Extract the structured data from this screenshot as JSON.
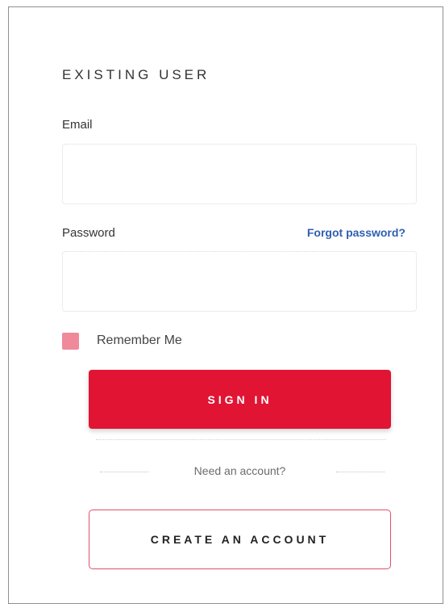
{
  "form": {
    "heading": "EXISTING USER",
    "email_label": "Email",
    "email_value": "",
    "password_label": "Password",
    "password_value": "",
    "forgot_password": "Forgot password?",
    "remember_me": "Remember Me",
    "remember_checked": true,
    "sign_in": "SIGN IN",
    "need_account": "Need an account?",
    "create_account": "CREATE AN ACCOUNT"
  },
  "colors": {
    "accent": "#e11434",
    "link": "#2f5fb0",
    "checkbox": "#f0899a",
    "outline_button_border": "#e0506a"
  }
}
